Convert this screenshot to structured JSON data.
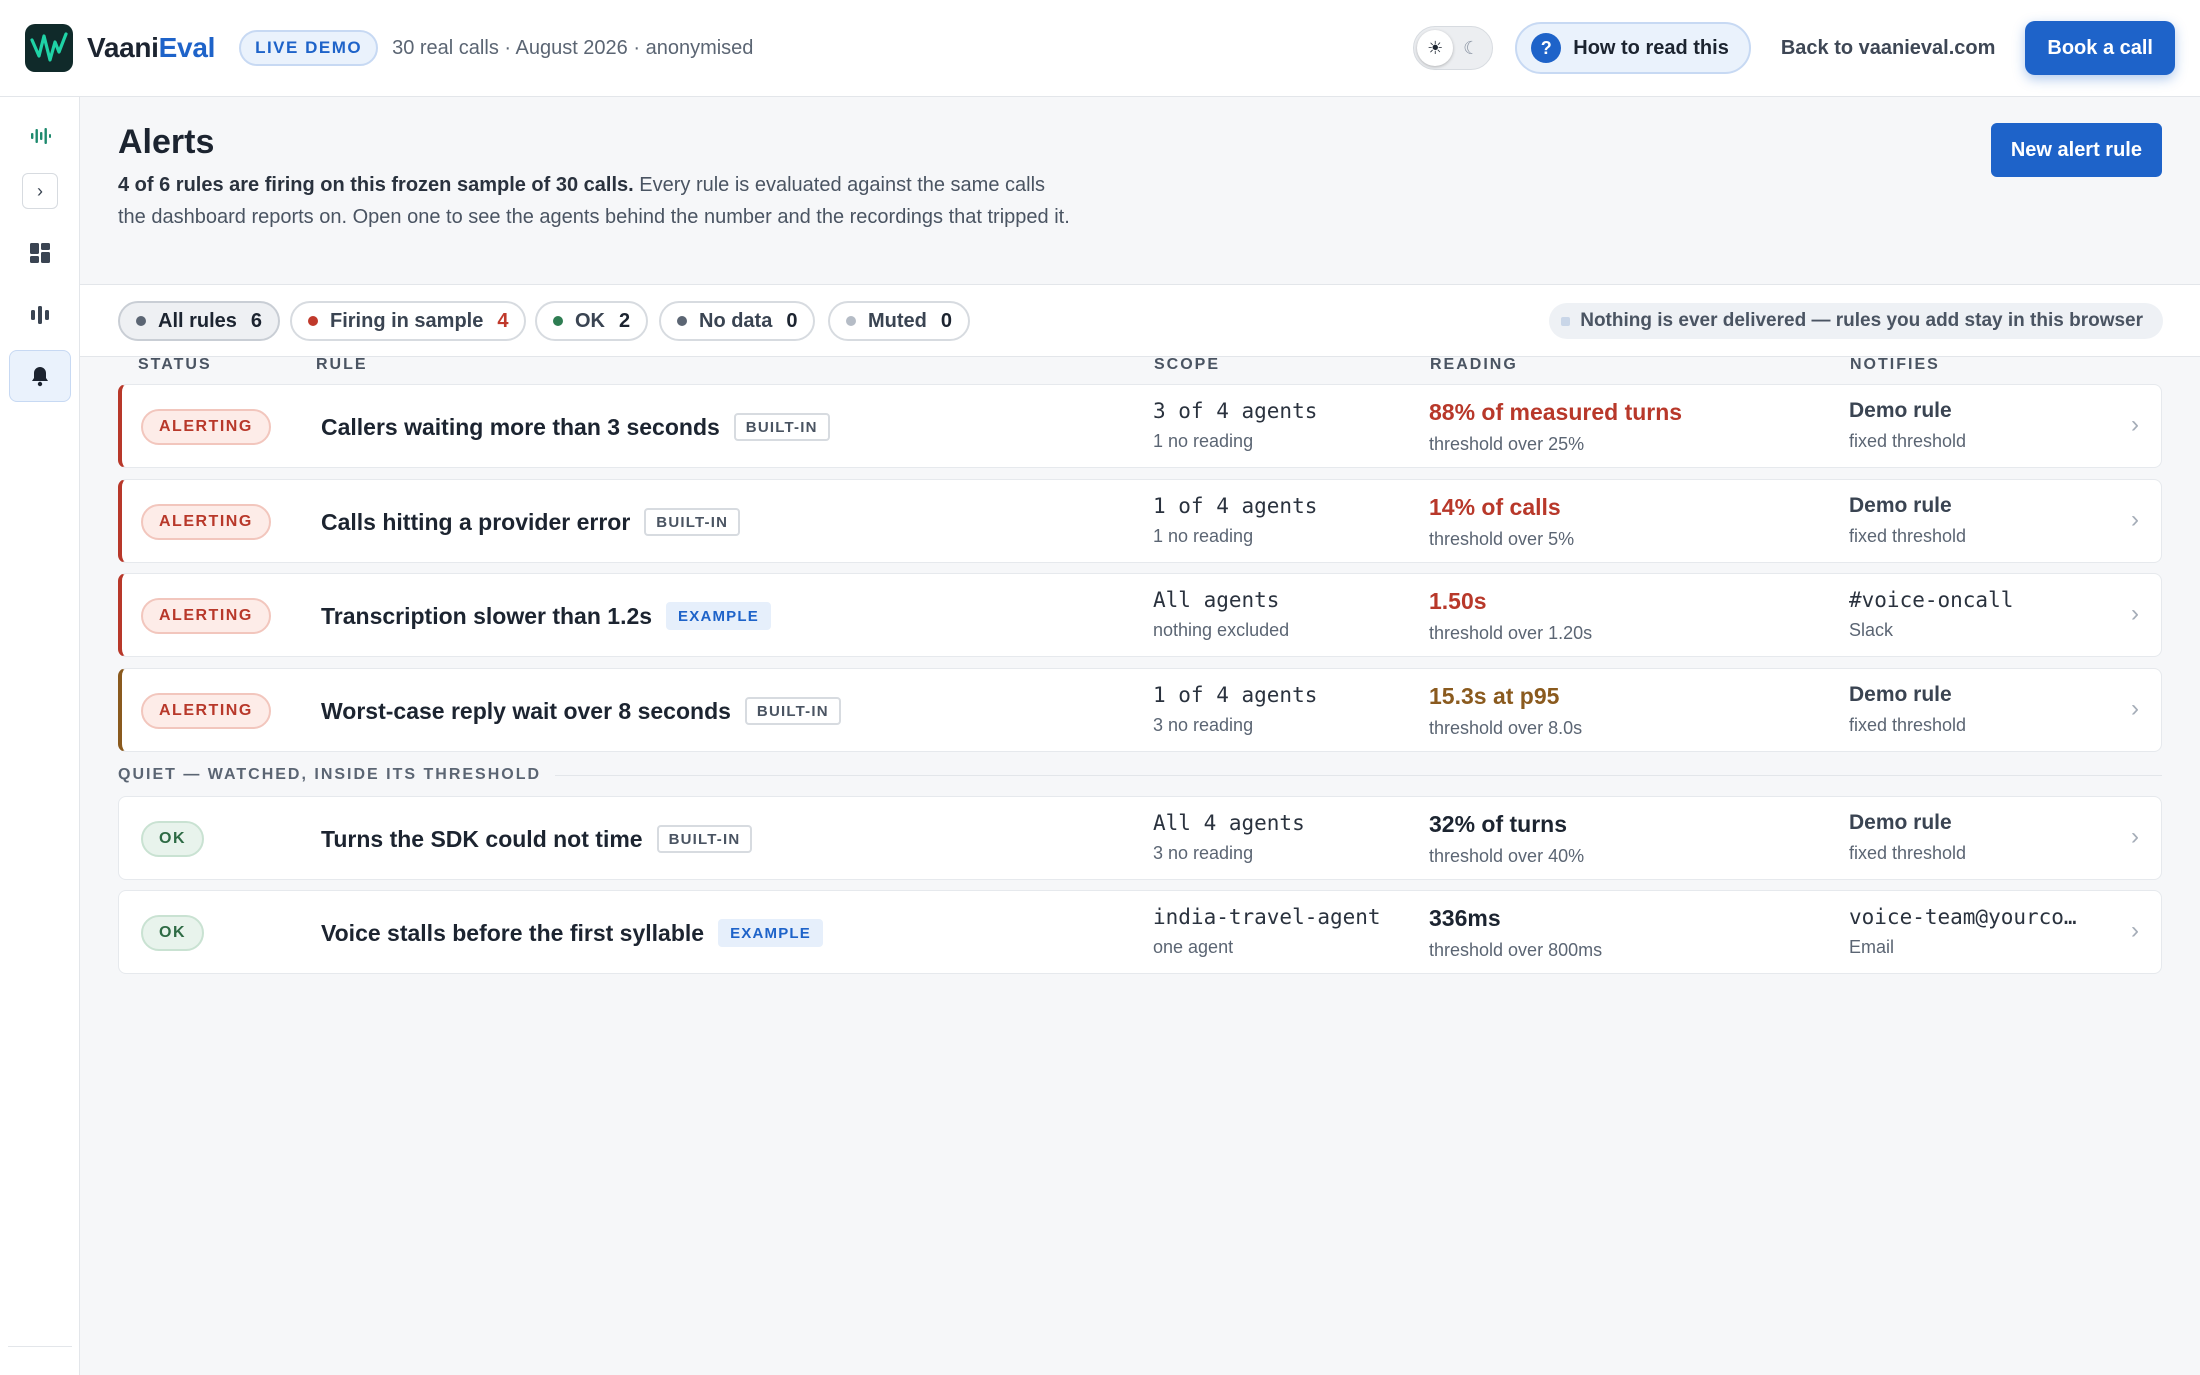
{
  "app": {
    "brand_prefix": "Vaani",
    "brand_suffix": "Eval",
    "live_badge": "LIVE DEMO",
    "meta": "30 real calls · August 2026 · anonymised"
  },
  "topbar": {
    "howto_label": "How to read this",
    "howto_icon": "?",
    "back_label": "Back to vaanieval.com",
    "book_label": "Book a call"
  },
  "page": {
    "title": "Alerts",
    "desc_bold": "4 of 6 rules are firing on this frozen sample of 30 calls.",
    "desc_rest": " Every rule is evaluated against the same calls the dashboard reports on. Open one to see the agents behind the number and the recordings that tripped it.",
    "new_rule_label": "New alert rule"
  },
  "filters": [
    {
      "label": "All rules",
      "count": "6",
      "dot": "#5b6573"
    },
    {
      "label": "Firing in sample",
      "count": "4",
      "dot": "#c0392b"
    },
    {
      "label": "OK",
      "count": "2",
      "dot": "#2e7d52"
    },
    {
      "label": "No data",
      "count": "0",
      "dot": "#5b6573"
    },
    {
      "label": "Muted",
      "count": "0",
      "dot": "#b5bcc6"
    }
  ],
  "notice": "Nothing is ever delivered — rules you add stay in this browser",
  "columns": {
    "status": "STATUS",
    "rule": "RULE",
    "scope": "SCOPE",
    "reading": "READING",
    "notifies": "NOTIFIES"
  },
  "rows": [
    {
      "status": "ALERTING",
      "name": "Callers waiting more than 3 seconds",
      "tag": "BUILT-IN",
      "scope": "3 of 4 agents",
      "scope_sub": "1 no reading",
      "reading": "88% of measured turns",
      "reading_sub": "threshold over 25%",
      "notifies": "Demo rule",
      "notifies_sub": "fixed threshold"
    },
    {
      "status": "ALERTING",
      "name": "Calls hitting a provider error",
      "tag": "BUILT-IN",
      "scope": "1 of 4 agents",
      "scope_sub": "1 no reading",
      "reading": "14% of calls",
      "reading_sub": "threshold over 5%",
      "notifies": "Demo rule",
      "notifies_sub": "fixed threshold"
    },
    {
      "status": "ALERTING",
      "name": "Transcription slower than 1.2s",
      "tag": "EXAMPLE",
      "scope": "All agents",
      "scope_sub": "nothing excluded",
      "reading": "1.50s",
      "reading_sub": "threshold over 1.20s",
      "notifies": "#voice-oncall",
      "notifies_sub": "Slack"
    },
    {
      "status": "ALERTING",
      "name": "Worst-case reply wait over 8 seconds",
      "tag": "BUILT-IN",
      "scope": "1 of 4 agents",
      "scope_sub": "3 no reading",
      "reading": "15.3s at p95",
      "reading_sub": "threshold over 8.0s",
      "notifies": "Demo rule",
      "notifies_sub": "fixed threshold"
    },
    {
      "status": "OK",
      "name": "Turns the SDK could not time",
      "tag": "BUILT-IN",
      "scope": "All 4 agents",
      "scope_sub": "3 no reading",
      "reading": "32% of turns",
      "reading_sub": "threshold over 40%",
      "notifies": "Demo rule",
      "notifies_sub": "fixed threshold"
    },
    {
      "status": "OK",
      "name": "Voice stalls before the first syllable",
      "tag": "EXAMPLE",
      "scope": "india-travel-agent",
      "scope_sub": "one agent",
      "reading": "336ms",
      "reading_sub": "threshold over 800ms",
      "notifies": "voice-team@yourco…",
      "notifies_sub": "Email"
    }
  ],
  "quiet_label": "QUIET — WATCHED, INSIDE ITS THRESHOLD",
  "icons": {
    "theme_sun": "☀",
    "theme_moon": "☾",
    "chevron": "›",
    "expand": "›"
  },
  "colors": {
    "accent": "#1e63c9",
    "alert": "#b8382a",
    "amber": "#8a5a1e",
    "ok": "#2e6b45"
  }
}
